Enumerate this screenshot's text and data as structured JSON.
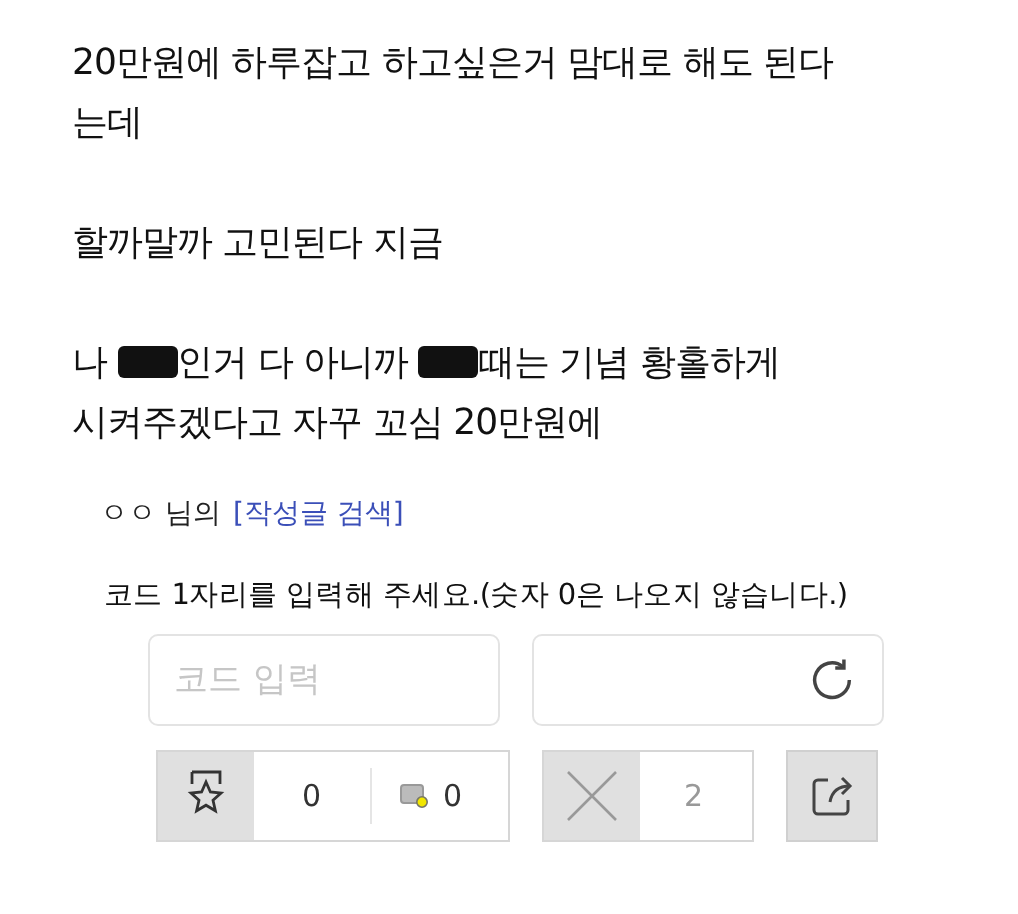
{
  "post": {
    "paragraphs": [
      {
        "lines": [
          [
            {
              "kind": "text",
              "text": "20만원에 하루잡고 하고싶은거 맘대로 해도 된다"
            }
          ],
          [
            {
              "kind": "text",
              "text": "는데"
            }
          ]
        ]
      },
      {
        "lines": [
          [
            {
              "kind": "text",
              "text": "할까말까 고민된다 지금"
            }
          ]
        ]
      },
      {
        "lines": [
          [
            {
              "kind": "text",
              "text": "나 "
            },
            {
              "kind": "redacted"
            },
            {
              "kind": "text",
              "text": "인거 다 아니까 "
            },
            {
              "kind": "redacted"
            },
            {
              "kind": "text",
              "text": "때는 기념 황홀하게"
            }
          ],
          [
            {
              "kind": "text",
              "text": "시켜주겠다고 자꾸 꼬심 20만원에"
            }
          ]
        ]
      }
    ]
  },
  "author": {
    "name": "ㅇㅇ 님의",
    "link": "[작성글 검색]"
  },
  "captcha": {
    "instruction": "코드 1자리를 입력해 주세요.(숫자 0은 나오지 않습니다.)",
    "placeholder": "코드 입력"
  },
  "actions": {
    "recommend_count": "0",
    "comment_count": "0",
    "dislike_count": "2"
  }
}
